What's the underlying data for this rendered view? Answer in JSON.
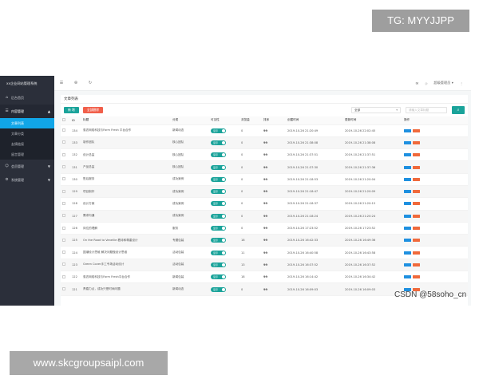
{
  "watermarks": {
    "top": "TG: MYYJJPP",
    "bottom": "www.skcgroupsaipl.com",
    "csdn": "CSDN @58soho_cn"
  },
  "sidebar": {
    "brand": "xx企业网站管理系统",
    "items": [
      {
        "label": "后台首页",
        "icon": "home-icon"
      },
      {
        "label": "内容管理",
        "icon": "list-icon",
        "expanded": true,
        "children": [
          "文章列表",
          "文章分类",
          "友情链接",
          "留言管理"
        ]
      },
      {
        "label": "会员管理",
        "icon": "user-icon"
      },
      {
        "label": "系统管理",
        "icon": "gear-icon"
      }
    ]
  },
  "topbar": {
    "user_label": "超级管理员"
  },
  "panel": {
    "title": "文章列表",
    "add_label": "新 增",
    "delete_label": "全部删除",
    "select_value": "全部",
    "search_placeholder": "请输入文章标题"
  },
  "table": {
    "headers": [
      "",
      "ID",
      "标题",
      "分类",
      "可见性",
      "浏览量",
      "排序",
      "创建时间",
      "更新时间",
      "操作"
    ],
    "rows": [
      {
        "id": "134",
        "title": "惠农网络科技与Farm Fresh 平台合作",
        "category": "新闻动态",
        "toggle": "显示",
        "views": "0",
        "sort": "99",
        "created": "2019-10-26 21:20:49",
        "updated": "2019-10-26 22:02:45"
      },
      {
        "id": "133",
        "title": "制作团队",
        "category": "核心团队",
        "toggle": "显示",
        "views": "0",
        "sort": "99",
        "created": "2019-10-26 21:38:08",
        "updated": "2019-10-26 21:38:08"
      },
      {
        "id": "132",
        "title": "设计总监",
        "category": "核心团队",
        "toggle": "显示",
        "views": "0",
        "sort": "99",
        "created": "2019-10-26 21:37:51",
        "updated": "2019-10-26 21:37:51"
      },
      {
        "id": "131",
        "title": "产品总监",
        "category": "核心团队",
        "toggle": "显示",
        "views": "0",
        "sort": "99",
        "created": "2019-10-26 21:37:30",
        "updated": "2019-10-26 21:37:36"
      },
      {
        "id": "130",
        "title": "售后服务",
        "category": "成功案例",
        "toggle": "显示",
        "views": "0",
        "sort": "99",
        "created": "2019-10-26 21:18:53",
        "updated": "2019-10-26 21:20:04"
      },
      {
        "id": "129",
        "title": "项目制作",
        "category": "成功案例",
        "toggle": "显示",
        "views": "0",
        "sort": "99",
        "created": "2019-10-26 21:18:47",
        "updated": "2019-10-26 21:20:09"
      },
      {
        "id": "128",
        "title": "设计方案",
        "category": "成功案例",
        "toggle": "显示",
        "views": "0",
        "sort": "99",
        "created": "2019-10-26 21:18:37",
        "updated": "2019-10-26 21:20:15"
      },
      {
        "id": "127",
        "title": "需求沟通",
        "category": "成功案例",
        "toggle": "显示",
        "views": "0",
        "sort": "99",
        "created": "2019-10-26 21:18:24",
        "updated": "2019-10-26 21:20:24"
      },
      {
        "id": "126",
        "title": "岗位的理解",
        "category": "服务",
        "toggle": "显示",
        "views": "0",
        "sort": "99",
        "created": "2019-10-26 17:23:52",
        "updated": "2019-10-26 17:23:52"
      },
      {
        "id": "125",
        "title": "On the Road to Vanellie 看待和尊重设计",
        "category": "专题包装",
        "toggle": "显示",
        "views": "18",
        "sort": "99",
        "created": "2019-10-26 16:42:33",
        "updated": "2019-10-26 16:49:36"
      },
      {
        "id": "124",
        "title": "国潮设计思维 解决问题做设计思维",
        "category": "活动包装",
        "toggle": "显示",
        "views": "11",
        "sort": "99",
        "created": "2019-10-26 16:40:58",
        "updated": "2019-10-26 16:43:58"
      },
      {
        "id": "123",
        "title": "Green Cover手工专场活动设计",
        "category": "活动包装",
        "toggle": "显示",
        "views": "13",
        "sort": "99",
        "created": "2019-10-26 16:37:52",
        "updated": "2019-10-26 16:37:52"
      },
      {
        "id": "122",
        "title": "惠农网络科技与Farm Fresh平台合作",
        "category": "新闻包装",
        "toggle": "显示",
        "views": "18",
        "sort": "99",
        "created": "2019-10-26 16:14:42",
        "updated": "2019-10-26 16:34:42"
      },
      {
        "id": "121",
        "title": "青春力点，成功只是时间问题",
        "category": "新闻动态",
        "toggle": "显示",
        "views": "0",
        "sort": "99",
        "created": "2019-10-26 16:09:03",
        "updated": "2019-10-26 16:09:03"
      }
    ]
  }
}
